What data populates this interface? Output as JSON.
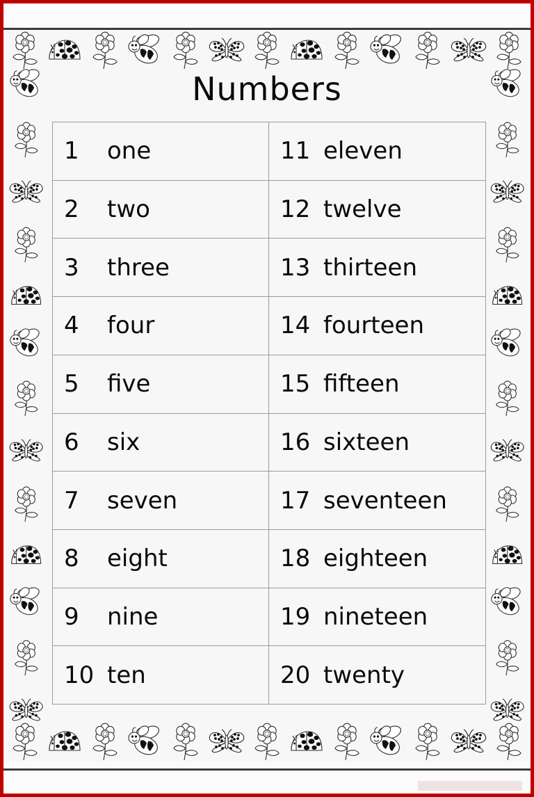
{
  "page": {
    "title": "Numbers",
    "frame_color": "#c00000",
    "rule_color": "#3a3a3a",
    "paper_color": "#f7f7f7",
    "grid_color": "#9a9a9a",
    "text_color": "#0a0a0a"
  },
  "table": {
    "columns": 2,
    "rows_per_column": 10,
    "left_column": [
      {
        "numeral": "1",
        "word": "one"
      },
      {
        "numeral": "2",
        "word": "two"
      },
      {
        "numeral": "3",
        "word": "three"
      },
      {
        "numeral": "4",
        "word": "four"
      },
      {
        "numeral": "5",
        "word": "five"
      },
      {
        "numeral": "6",
        "word": "six"
      },
      {
        "numeral": "7",
        "word": "seven"
      },
      {
        "numeral": "8",
        "word": "eight"
      },
      {
        "numeral": "9",
        "word": "nine"
      },
      {
        "numeral": "10",
        "word": "ten"
      }
    ],
    "right_column": [
      {
        "numeral": "11",
        "word": "eleven"
      },
      {
        "numeral": "12",
        "word": "twelve"
      },
      {
        "numeral": "13",
        "word": "thirteen"
      },
      {
        "numeral": "14",
        "word": "fourteen"
      },
      {
        "numeral": "15",
        "word": "fifteen"
      },
      {
        "numeral": "16",
        "word": "sixteen"
      },
      {
        "numeral": "17",
        "word": "seventeen"
      },
      {
        "numeral": "18",
        "word": "eighteen"
      },
      {
        "numeral": "19",
        "word": "nineteen"
      },
      {
        "numeral": "20",
        "word": "twenty"
      }
    ]
  },
  "decorations": {
    "top_sequence": [
      "flower-icon",
      "ladybug-icon",
      "flower-icon",
      "bee-icon",
      "flower-icon",
      "butterfly-icon",
      "flower-icon",
      "ladybug-icon",
      "flower-icon",
      "bee-icon",
      "flower-icon",
      "butterfly-icon",
      "flower-icon"
    ],
    "bottom_sequence": [
      "flower-icon",
      "ladybug-icon",
      "flower-icon",
      "bee-icon",
      "flower-icon",
      "butterfly-icon",
      "flower-icon",
      "ladybug-icon",
      "flower-icon",
      "bee-icon",
      "flower-icon",
      "butterfly-icon",
      "flower-icon"
    ],
    "left_sequence": [
      "bee-icon",
      "flower-icon",
      "butterfly-icon",
      "flower-icon",
      "ladybug-icon",
      "bee-icon",
      "flower-icon",
      "butterfly-icon",
      "flower-icon",
      "ladybug-icon",
      "bee-icon",
      "flower-icon",
      "butterfly-icon"
    ],
    "right_sequence": [
      "bee-icon",
      "flower-icon",
      "butterfly-icon",
      "flower-icon",
      "ladybug-icon",
      "bee-icon",
      "flower-icon",
      "butterfly-icon",
      "flower-icon",
      "ladybug-icon",
      "bee-icon",
      "flower-icon",
      "butterfly-icon"
    ]
  }
}
